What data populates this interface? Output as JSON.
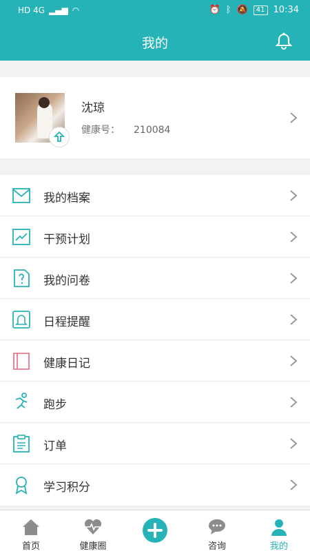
{
  "status": {
    "network": "HD 4G",
    "battery": "41",
    "time": "10:34"
  },
  "header": {
    "title": "我的"
  },
  "profile": {
    "name": "沈琼",
    "id_label": "健康号：",
    "id_value": "210084"
  },
  "menu": [
    {
      "label": "我的档案",
      "icon": "envelope-icon"
    },
    {
      "label": "干预计划",
      "icon": "trend-chart-icon"
    },
    {
      "label": "我的问卷",
      "icon": "question-doc-icon"
    },
    {
      "label": "日程提醒",
      "icon": "bell-icon"
    },
    {
      "label": "健康日记",
      "icon": "diary-icon"
    },
    {
      "label": "跑步",
      "icon": "running-icon"
    },
    {
      "label": "订单",
      "icon": "clipboard-icon"
    },
    {
      "label": "学习积分",
      "icon": "award-icon"
    }
  ],
  "tabs": [
    {
      "label": "首页",
      "icon": "home-icon"
    },
    {
      "label": "健康圈",
      "icon": "heart-pulse-icon"
    },
    {
      "label": "",
      "icon": "plus-icon"
    },
    {
      "label": "咨询",
      "icon": "chat-icon"
    },
    {
      "label": "我的",
      "icon": "user-icon",
      "active": true
    }
  ],
  "colors": {
    "accent": "#25b3b8",
    "diary_icon": "#e67b8a"
  }
}
